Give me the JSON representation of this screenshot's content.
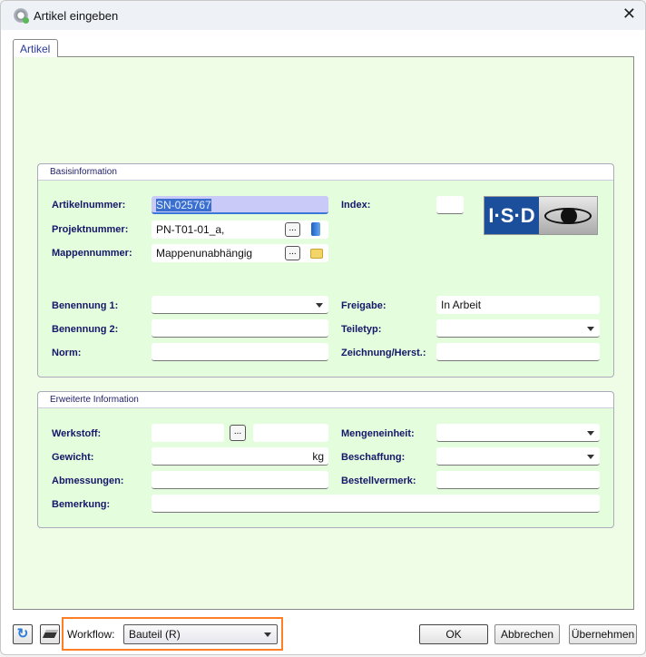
{
  "window": {
    "title": "Artikel eingeben",
    "close": "✕"
  },
  "tab": "Artikel",
  "basis": {
    "title": "Basisinformation",
    "artikelnummer": {
      "label": "Artikelnummer:",
      "value": "SN-025767"
    },
    "projektnummer": {
      "label": "Projektnummer:",
      "value": "PN-T01-01_a,"
    },
    "mappennummer": {
      "label": "Mappennummer:",
      "value": "Mappenunabhängig"
    },
    "index": {
      "label": "Index:",
      "value": ""
    },
    "benennung1": {
      "label": "Benennung 1:",
      "value": ""
    },
    "benennung2": {
      "label": "Benennung 2:",
      "value": ""
    },
    "norm": {
      "label": "Norm:",
      "value": ""
    },
    "freigabe": {
      "label": "Freigabe:",
      "value": "In Arbeit"
    },
    "teiletyp": {
      "label": "Teiletyp:",
      "value": ""
    },
    "zeichnung": {
      "label": "Zeichnung/Herst.:",
      "value": ""
    },
    "logo": "I·S·D"
  },
  "erweitert": {
    "title": "Erweiterte Information",
    "werkstoff": {
      "label": "Werkstoff:",
      "value": ""
    },
    "gewicht": {
      "label": "Gewicht:",
      "unit": "kg"
    },
    "abmessungen": {
      "label": "Abmessungen:",
      "value": ""
    },
    "bemerkung": {
      "label": "Bemerkung:",
      "value": ""
    },
    "mengeneinheit": {
      "label": "Mengeneinheit:",
      "value": ""
    },
    "beschaffung": {
      "label": "Beschaffung:",
      "value": ""
    },
    "bestellvermerk": {
      "label": "Bestellvermerk:",
      "value": ""
    }
  },
  "dots": "...",
  "footer": {
    "workflow_label": "Workflow:",
    "workflow_value": "Bauteil (R)",
    "ok": "OK",
    "cancel": "Abbrechen",
    "apply": "Übernehmen"
  },
  "colors": {
    "highlight": "#ff7f27",
    "label": "#16166a"
  }
}
